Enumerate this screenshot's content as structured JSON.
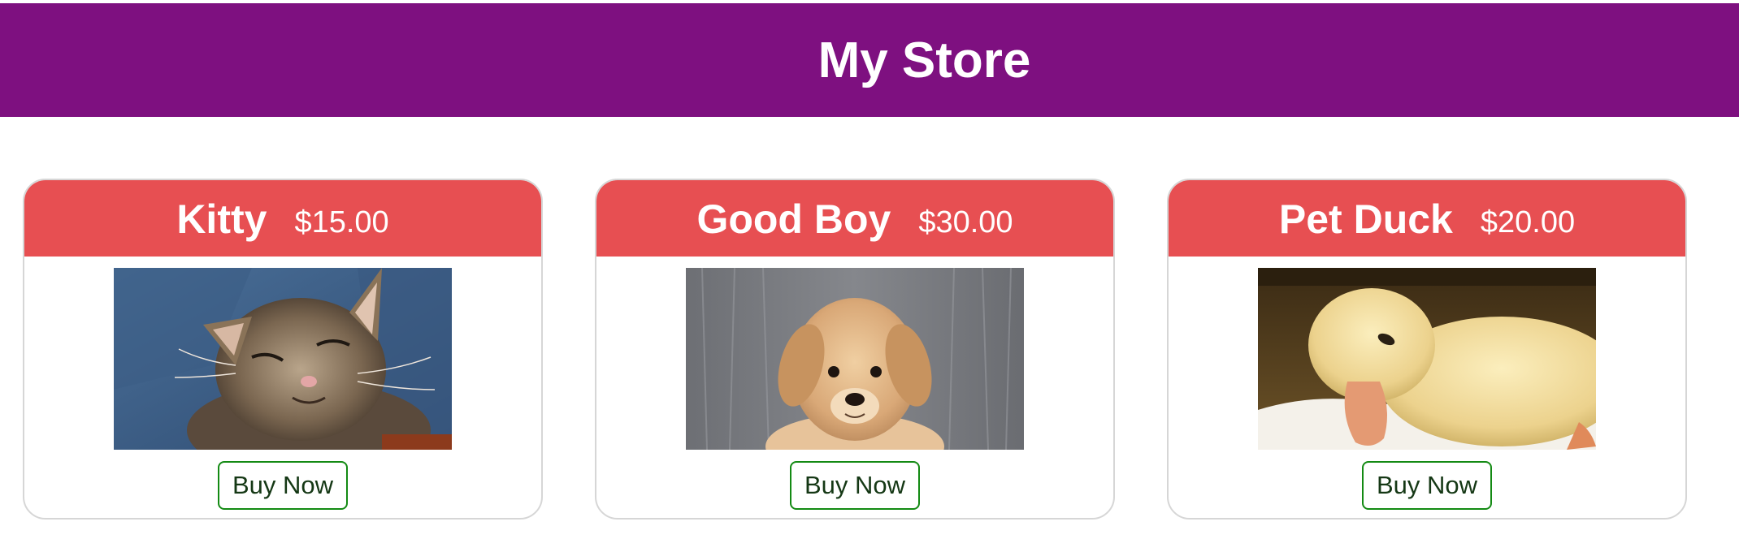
{
  "header": {
    "title": "My Store",
    "background": "#7e1080"
  },
  "products": [
    {
      "name": "Kitty",
      "price": "$15.00",
      "button_label": "Buy Now",
      "image": "kitten-photo"
    },
    {
      "name": "Good Boy",
      "price": "$30.00",
      "button_label": "Buy Now",
      "image": "puppy-photo"
    },
    {
      "name": "Pet Duck",
      "price": "$20.00",
      "button_label": "Buy Now",
      "image": "duckling-photo"
    }
  ],
  "colors": {
    "card_header": "#e74f52",
    "button_border": "#138a13",
    "card_border": "#d6d6d6"
  }
}
